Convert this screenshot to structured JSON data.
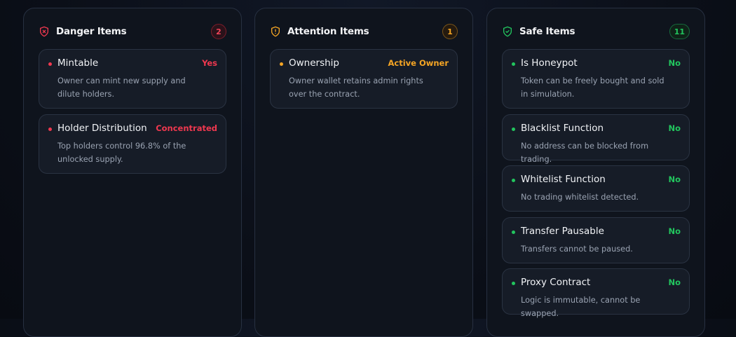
{
  "danger": {
    "title": "Danger Items",
    "count": "2",
    "icon": "shield-x-icon",
    "items": [
      {
        "name": "Mintable",
        "status": "Yes",
        "desc": "Owner can mint new supply and dilute holders."
      },
      {
        "name": "Holder Distribution",
        "status": "Concentrated",
        "desc": "Top holders control 96.8% of the unlocked supply."
      }
    ]
  },
  "attention": {
    "title": "Attention Items",
    "count": "1",
    "icon": "shield-alert-icon",
    "items": [
      {
        "name": "Ownership",
        "status": "Active Owner",
        "desc": "Owner wallet retains admin rights over the contract."
      }
    ]
  },
  "safe": {
    "title": "Safe Items",
    "count": "11",
    "icon": "shield-check-icon",
    "items": [
      {
        "name": "Is Honeypot",
        "status": "No",
        "desc": "Token can be freely bought and sold in simulation."
      },
      {
        "name": "Blacklist Function",
        "status": "No",
        "desc": "No address can be blocked from trading."
      },
      {
        "name": "Whitelist Function",
        "status": "No",
        "desc": "No trading whitelist detected."
      },
      {
        "name": "Transfer Pausable",
        "status": "No",
        "desc": "Transfers cannot be paused."
      },
      {
        "name": "Proxy Contract",
        "status": "No",
        "desc": "Logic is immutable, cannot be swapped."
      }
    ]
  },
  "colors": {
    "danger": "#f0384f",
    "attention": "#f5a524",
    "safe": "#22c55e"
  }
}
